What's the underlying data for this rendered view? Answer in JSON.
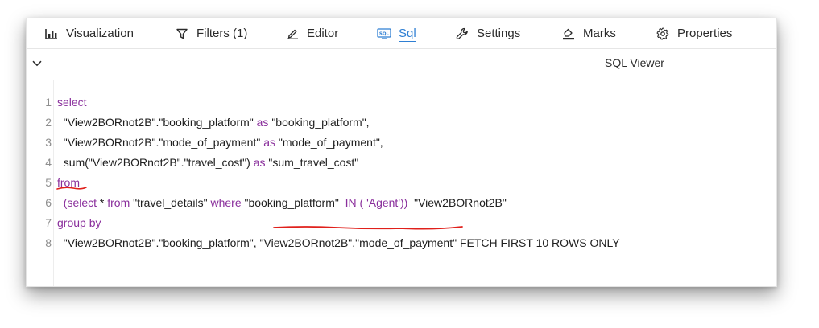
{
  "tabs": [
    {
      "label": "Visualization",
      "icon": "bar-chart-icon"
    },
    {
      "label": "Filters (1)",
      "icon": "filter-icon"
    },
    {
      "label": "Editor",
      "icon": "pencil-icon"
    },
    {
      "label": "Sql",
      "icon": "sql-icon",
      "active": true
    },
    {
      "label": "Settings",
      "icon": "wrench-icon"
    },
    {
      "label": "Marks",
      "icon": "paint-bucket-icon"
    },
    {
      "label": "Properties",
      "icon": "gear-icon"
    }
  ],
  "viewer": {
    "title": "SQL Viewer"
  },
  "colors": {
    "accent": "#2f7fd3",
    "keyword": "#8a2f9c",
    "annotation": "#e0201b"
  },
  "code": {
    "lines": [
      {
        "num": "1",
        "tokens": [
          {
            "t": "select",
            "kw": true
          }
        ]
      },
      {
        "num": "2",
        "tokens": [
          {
            "t": "  \"View2BORnot2B\".\"booking_platform\" "
          },
          {
            "t": "as",
            "kw": true
          },
          {
            "t": " \"booking_platform\","
          }
        ]
      },
      {
        "num": "3",
        "tokens": [
          {
            "t": "  \"View2BORnot2B\".\"mode_of_payment\" "
          },
          {
            "t": "as",
            "kw": true
          },
          {
            "t": " \"mode_of_payment\","
          }
        ]
      },
      {
        "num": "4",
        "tokens": [
          {
            "t": "  sum(\"View2BORnot2B\".\"travel_cost\") "
          },
          {
            "t": "as",
            "kw": true
          },
          {
            "t": " \"sum_travel_cost\""
          }
        ]
      },
      {
        "num": "5",
        "tokens": [
          {
            "t": "from",
            "kw": true
          }
        ]
      },
      {
        "num": "6",
        "tokens": [
          {
            "t": "  (select",
            "kw": true
          },
          {
            "t": " * "
          },
          {
            "t": "from",
            "kw": true
          },
          {
            "t": " \"travel_details\" "
          },
          {
            "t": "where",
            "kw": true
          },
          {
            "t": " \"booking_platform\"  "
          },
          {
            "t": "IN ( 'Agent'))",
            "kw": true
          },
          {
            "t": "  \"View2BORnot2B\""
          }
        ]
      },
      {
        "num": "7",
        "tokens": [
          {
            "t": "group by",
            "kw": true
          }
        ]
      },
      {
        "num": "8",
        "tokens": [
          {
            "t": "  \"View2BORnot2B\".\"booking_platform\", \"View2BORnot2B\".\"mode_of_payment\" FETCH FIRST 10 ROWS ONLY"
          }
        ]
      }
    ]
  }
}
